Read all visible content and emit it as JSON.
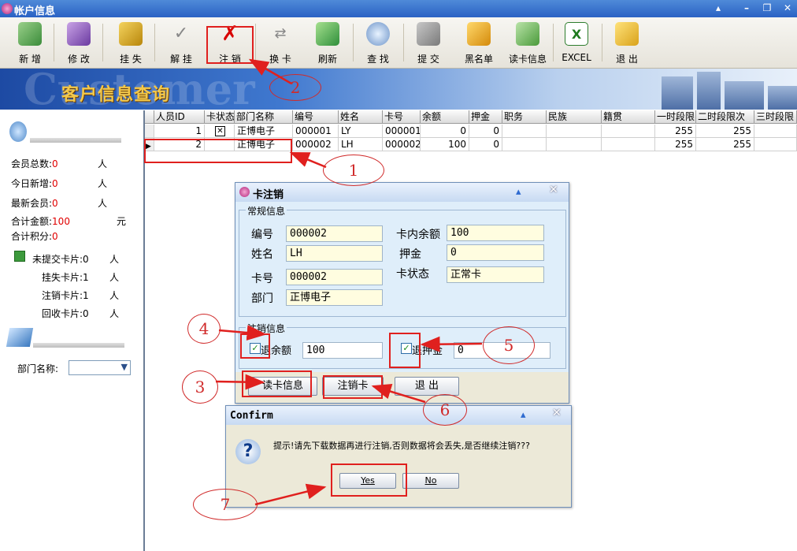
{
  "window": {
    "title": "帐户信息"
  },
  "toolbar": [
    {
      "label": "新 增",
      "icon": "add-user-icon"
    },
    {
      "label": "修 改",
      "icon": "edit-pen-icon"
    },
    {
      "label": "挂 失",
      "icon": "lock-user-icon"
    },
    {
      "label": "解 挂",
      "icon": "check-icon"
    },
    {
      "label": "注 销",
      "icon": "red-x-icon"
    },
    {
      "label": "换 卡",
      "icon": "swap-card-icon"
    },
    {
      "label": "刷新",
      "icon": "refresh-icon"
    },
    {
      "label": "查 找",
      "icon": "magnifier-icon"
    },
    {
      "label": "提 交",
      "icon": "submit-icon"
    },
    {
      "label": "黑名单",
      "icon": "blacklist-icon"
    },
    {
      "label": "读卡信息",
      "icon": "read-card-icon"
    },
    {
      "label": "EXCEL",
      "icon": "excel-icon"
    },
    {
      "label": "退 出",
      "icon": "exit-icon"
    }
  ],
  "banner": {
    "watermark": "Customer",
    "title": "客户信息查询"
  },
  "left": {
    "stats": [
      {
        "label": "会员总数:",
        "value": "0",
        "unit": "人"
      },
      {
        "label": "今日新增:",
        "value": "0",
        "unit": "人"
      },
      {
        "label": "最新会员:",
        "value": "0",
        "unit": "人"
      },
      {
        "label": "合计金额:",
        "value": "100",
        "unit": "元"
      },
      {
        "label": "合计积分:",
        "value": "0",
        "unit": ""
      }
    ],
    "cards": [
      {
        "label": "未提交卡片:",
        "value": "0",
        "unit": "人"
      },
      {
        "label": "挂失卡片:",
        "value": "1",
        "unit": "人"
      },
      {
        "label": "注销卡片:",
        "value": "1",
        "unit": "人"
      },
      {
        "label": "回收卡片:",
        "value": "0",
        "unit": "人"
      }
    ],
    "dept_label": "部门名称:"
  },
  "grid": {
    "columns": [
      "人员ID",
      "卡状态",
      "部门名称",
      "编号",
      "姓名",
      "卡号",
      "余额",
      "押金",
      "职务",
      "民族",
      "籍贯",
      "一时段限",
      "二时段限次",
      "三时段限"
    ],
    "rows": [
      [
        "1",
        "",
        "正博电子",
        "000001",
        "LY",
        "000001",
        "0",
        "0",
        "",
        "",
        "",
        "255",
        "255",
        ""
      ],
      [
        "2",
        "",
        "正博电子",
        "000002",
        "LH",
        "000002",
        "100",
        "0",
        "",
        "",
        "",
        "255",
        "255",
        ""
      ]
    ]
  },
  "dialog_cancel": {
    "title": "卡注销",
    "group_general": "常规信息",
    "fields": {
      "no_label": "编号",
      "no_value": "000002",
      "name_label": "姓名",
      "name_value": "LH",
      "card_label": "卡号",
      "card_value": "000002",
      "dept_label": "部门",
      "dept_value": "正博电子",
      "balance_label": "卡内余额",
      "balance_value": "100",
      "deposit_label": "押金",
      "deposit_value": "0",
      "status_label": "卡状态",
      "status_value": "正常卡"
    },
    "group_cancel": "注销信息",
    "refund_balance_label": "退余额",
    "refund_balance_value": "100",
    "refund_deposit_label": "退押金",
    "refund_deposit_value": "0",
    "btn_read": "读卡信息",
    "btn_cancel": "注销卡",
    "btn_exit": "退 出"
  },
  "dialog_confirm": {
    "title": "Confirm",
    "message": "提示!请先下载数据再进行注销,否则数据将会丢失,是否继续注销???",
    "yes": "Yes",
    "no": "No"
  },
  "callouts": [
    "1",
    "2",
    "3",
    "4",
    "5",
    "6",
    "7"
  ],
  "colors": {
    "annotation": "#e0201e",
    "title_bar": "#2a62c4",
    "stat_value": "#e00000"
  }
}
